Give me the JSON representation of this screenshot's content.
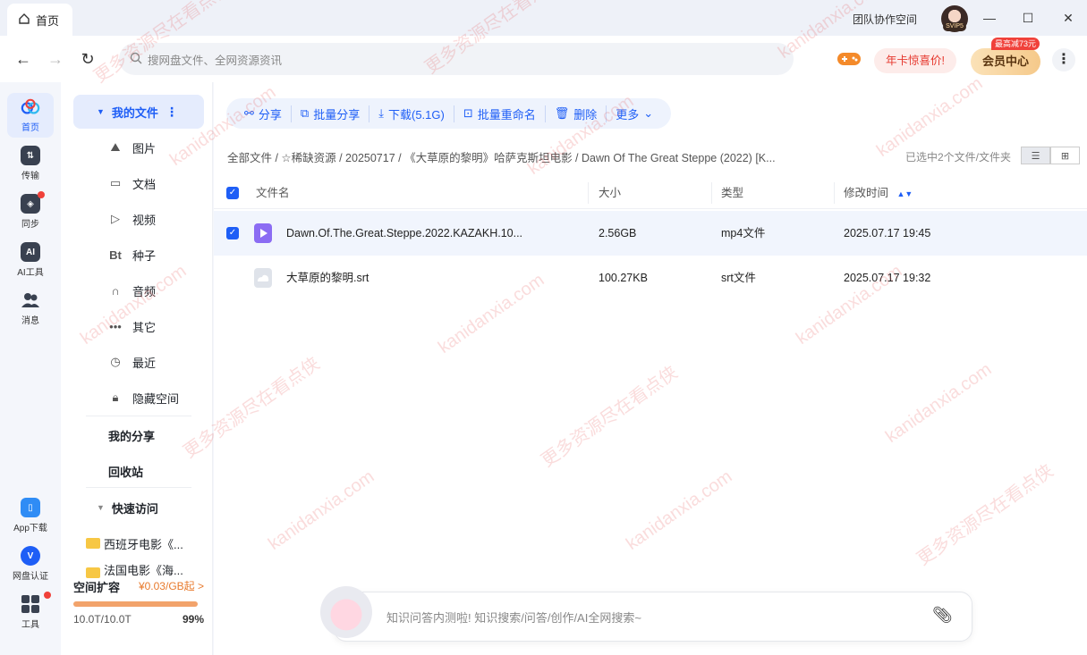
{
  "titlebar": {
    "home_tab": "首页",
    "team_space": "团队协作空间",
    "avatar_badge": "SVIP5"
  },
  "toolbar": {
    "search_placeholder": "搜网盘文件、全网资源资讯",
    "promo": "年卡惊喜价!",
    "vip_center": "会员中心",
    "vip_tag": "最高减73元"
  },
  "rail": {
    "items": [
      {
        "label": "首页",
        "icon": "cloud-icon",
        "active": true
      },
      {
        "label": "传输",
        "icon": "transfer-icon"
      },
      {
        "label": "同步",
        "icon": "sync-icon",
        "dot": true
      },
      {
        "label": "AI工具",
        "icon": "ai-icon"
      },
      {
        "label": "消息",
        "icon": "message-icon"
      }
    ],
    "bottom": [
      {
        "label": "App下载",
        "icon": "phone-icon"
      },
      {
        "label": "网盘认证",
        "icon": "verify-icon"
      },
      {
        "label": "工具",
        "icon": "tools-icon",
        "dot": true
      }
    ]
  },
  "sidebar": {
    "my_files": "我的文件",
    "categories": [
      {
        "label": "图片",
        "icon": "image-icon"
      },
      {
        "label": "文档",
        "icon": "document-icon"
      },
      {
        "label": "视频",
        "icon": "video-icon"
      },
      {
        "label": "种子",
        "icon": "torrent-icon",
        "glyph": "Bt"
      },
      {
        "label": "音频",
        "icon": "headphones-icon"
      },
      {
        "label": "其它",
        "icon": "more-dots-icon"
      },
      {
        "label": "最近",
        "icon": "clock-icon"
      },
      {
        "label": "隐藏空间",
        "icon": "lock-icon"
      }
    ],
    "my_share": "我的分享",
    "recycle": "回收站",
    "quick_access": "快速访问",
    "quick_items": [
      "西班牙电影《...",
      "法国电影《海..."
    ],
    "expand_label": "空间扩容",
    "expand_price": "¥0.03/GB起 >",
    "storage": "10.0T/10.0T",
    "storage_pct": "99%",
    "storage_fraction": 0.99
  },
  "actions": [
    {
      "label": "分享",
      "icon": "share-icon"
    },
    {
      "label": "批量分享",
      "icon": "batch-share-icon"
    },
    {
      "label": "下载(5.1G)",
      "icon": "download-icon"
    },
    {
      "label": "批量重命名",
      "icon": "rename-icon"
    },
    {
      "label": "删除",
      "icon": "trash-icon"
    },
    {
      "label": "更多",
      "icon": "chevron-down-icon"
    }
  ],
  "breadcrumb": "全部文件 / ☆稀缺资源 / 20250717 / 《大草原的黎明》哈萨克斯坦电影 / Dawn Of The Great Steppe (2022) [K...",
  "selection": "已选中2个文件/文件夹",
  "table": {
    "headers": [
      "文件名",
      "大小",
      "类型",
      "修改时间"
    ],
    "rows": [
      {
        "name": "Dawn.Of.The.Great.Steppe.2022.KAZAKH.10...",
        "size": "2.56GB",
        "type": "mp4文件",
        "time": "2025.07.17 19:45",
        "selected": true
      },
      {
        "name": "大草原的黎明.srt",
        "size": "100.27KB",
        "type": "srt文件",
        "time": "2025.07.17 19:32",
        "selected": false
      }
    ]
  },
  "ai": {
    "placeholder": "知识问答内测啦! 知识搜索/问答/创作/AI全网搜索~"
  },
  "watermark": {
    "site": "kanidanxia.com",
    "slogan": "更多资源尽在看点侠"
  },
  "colors": {
    "accent": "#1e5ef6",
    "promo_red": "#e6392f",
    "watermark": "#e63c3c"
  }
}
